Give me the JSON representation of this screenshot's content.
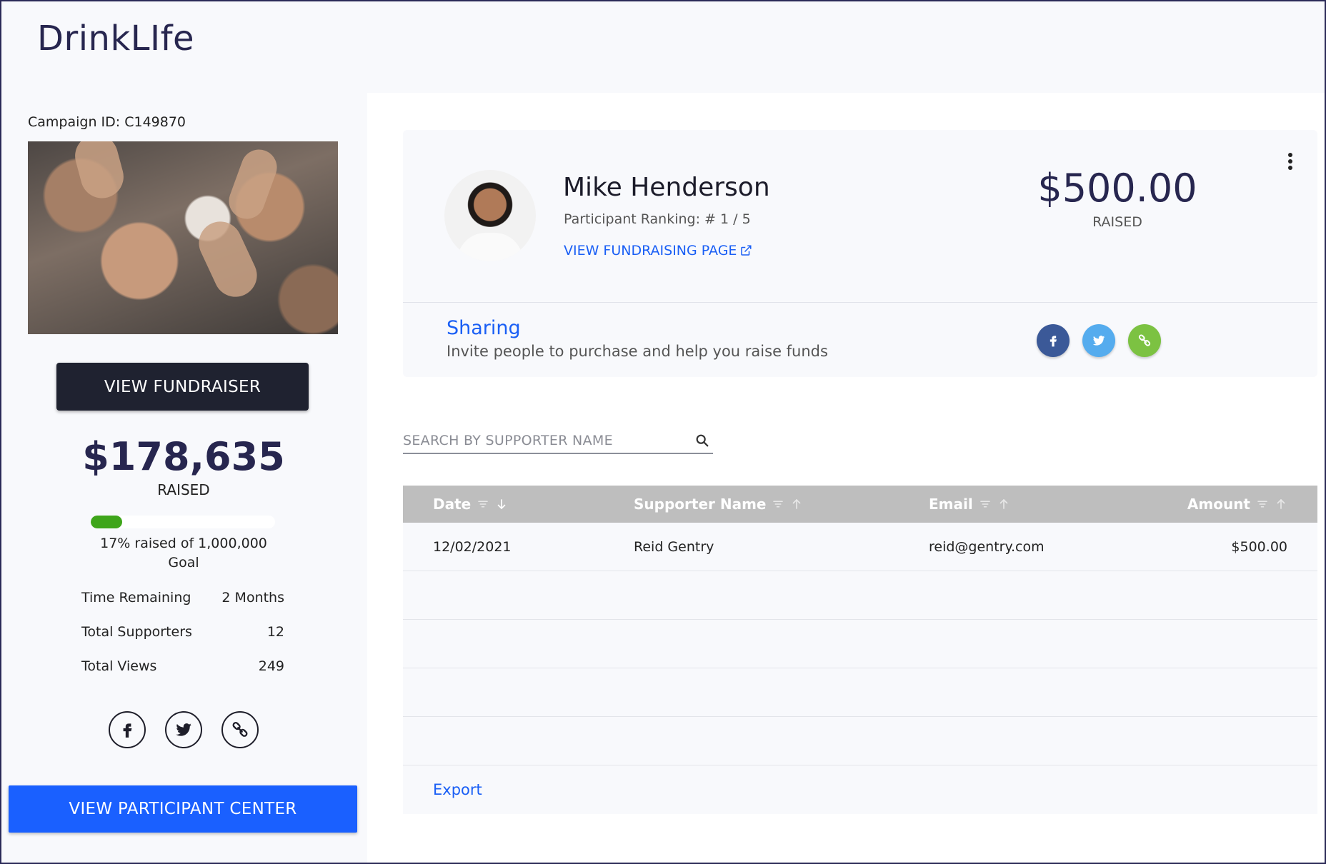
{
  "app": {
    "brand": "DrinkLIfe"
  },
  "campaign": {
    "id_label": "Campaign ID: C149870",
    "view_fundraiser_label": "VIEW FUNDRAISER",
    "raised_amount": "$178,635",
    "raised_label": "RAISED",
    "progress_fraction": 0.17,
    "goal_text_line1": "17% raised of 1,000,000",
    "goal_text_line2": "Goal",
    "stats": [
      {
        "label": "Time Remaining",
        "value": "2 Months"
      },
      {
        "label": "Total Supporters",
        "value": "12"
      },
      {
        "label": "Total Views",
        "value": "249"
      }
    ],
    "social_icons": [
      "facebook-icon",
      "twitter-icon",
      "link-icon"
    ],
    "view_participant_center_label": "VIEW PARTICIPANT CENTER"
  },
  "participant": {
    "name": "Mike Henderson",
    "ranking": "Participant Ranking: # 1 / 5",
    "view_page_label": "VIEW FUNDRAISING PAGE",
    "raised_amount": "$500.00",
    "raised_label": "RAISED"
  },
  "sharing": {
    "title": "Sharing",
    "subtitle": "Invite people to purchase and help you raise funds",
    "colors": {
      "facebook": "#3b5998",
      "twitter": "#55acee",
      "link": "#7cc242"
    }
  },
  "search": {
    "placeholder": "SEARCH BY SUPPORTER NAME",
    "value": ""
  },
  "table": {
    "headers": {
      "date": "Date",
      "supporter_name": "Supporter Name",
      "email": "Email",
      "amount": "Amount"
    },
    "rows": [
      {
        "date": "12/02/2021",
        "supporter_name": "Reid Gentry",
        "email": "reid@gentry.com",
        "amount": "$500.00"
      },
      {
        "date": "",
        "supporter_name": "",
        "email": "",
        "amount": ""
      },
      {
        "date": "",
        "supporter_name": "",
        "email": "",
        "amount": ""
      },
      {
        "date": "",
        "supporter_name": "",
        "email": "",
        "amount": ""
      },
      {
        "date": "",
        "supporter_name": "",
        "email": "",
        "amount": ""
      }
    ],
    "export_label": "Export"
  },
  "colors": {
    "accent_blue": "#1a60ff",
    "link_blue": "#1a5ff5",
    "dark_navy": "#27264f",
    "progress_green": "#3ea51a",
    "table_header_bg": "#bebebe"
  }
}
